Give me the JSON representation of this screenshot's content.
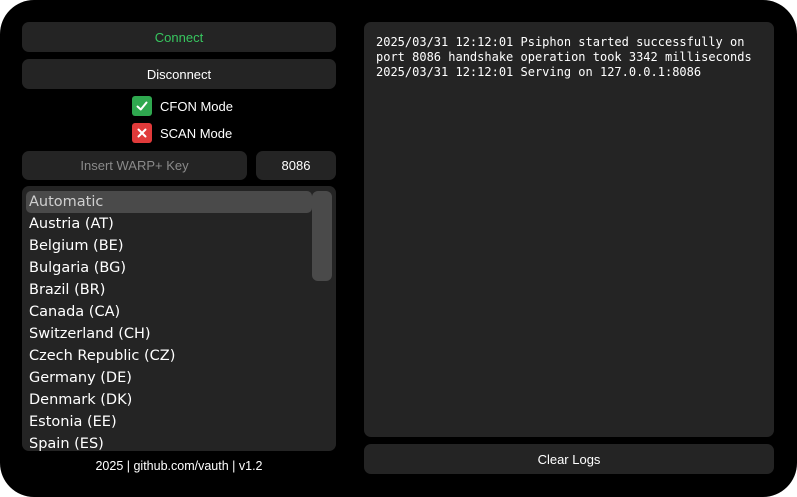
{
  "buttons": {
    "connect": "Connect",
    "disconnect": "Disconnect",
    "clear_logs": "Clear Logs"
  },
  "options": {
    "cfon": {
      "label": "CFON Mode",
      "checked": true
    },
    "scan": {
      "label": "SCAN Mode",
      "checked": false
    }
  },
  "fields": {
    "warp_key_placeholder": "Insert WARP+ Key",
    "port": "8086"
  },
  "countries": {
    "selected": "Automatic",
    "items": [
      "Automatic",
      "Austria (AT)",
      "Belgium (BE)",
      "Bulgaria (BG)",
      "Brazil (BR)",
      "Canada (CA)",
      "Switzerland (CH)",
      "Czech Republic (CZ)",
      "Germany (DE)",
      "Denmark (DK)",
      "Estonia (EE)",
      "Spain (ES)"
    ]
  },
  "footer": "2025 | github.com/vauth | v1.2",
  "log": "2025/03/31 12:12:01 Psiphon started successfully on port 8086 handshake operation took 3342 milliseconds\n2025/03/31 12:12:01 Serving on 127.0.0.1:8086",
  "colors": {
    "background": "#000000",
    "panel": "#242424",
    "connect_text": "#37c65f",
    "check_on": "#2fa84f",
    "check_off": "#e03a3a",
    "selection": "#4a4a4a"
  }
}
